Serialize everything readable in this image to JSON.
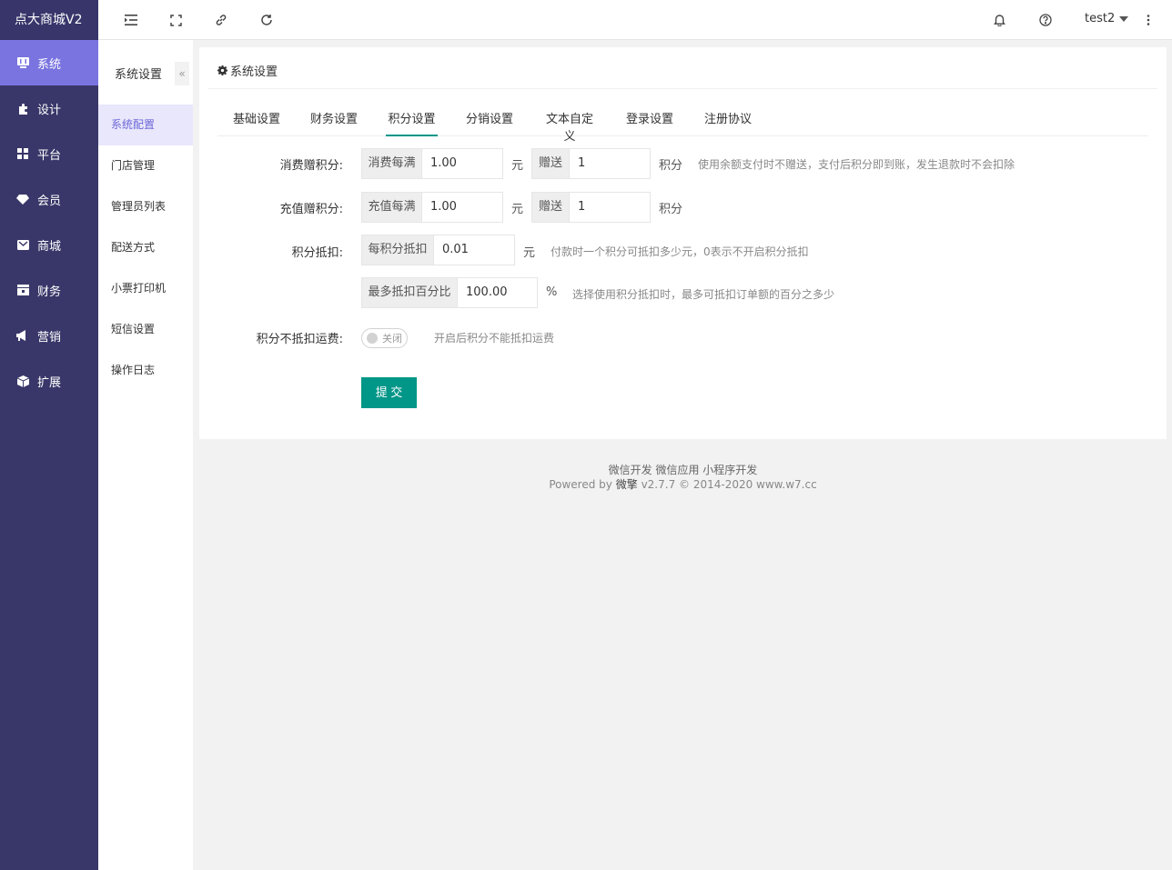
{
  "app": {
    "title": "点大商城V2"
  },
  "nav": [
    {
      "label": "系统",
      "icon": "system-icon",
      "active": true
    },
    {
      "label": "设计",
      "icon": "puzzle-icon"
    },
    {
      "label": "平台",
      "icon": "grid-icon"
    },
    {
      "label": "会员",
      "icon": "gem-icon"
    },
    {
      "label": "商城",
      "icon": "mail-icon"
    },
    {
      "label": "财务",
      "icon": "wallet-icon"
    },
    {
      "label": "营销",
      "icon": "megaphone-icon"
    },
    {
      "label": "扩展",
      "icon": "cube-icon"
    }
  ],
  "header": {
    "user": "test2"
  },
  "subnav": {
    "title": "系统设置",
    "collapse": "«",
    "items": [
      "系统配置",
      "门店管理",
      "管理员列表",
      "配送方式",
      "小票打印机",
      "短信设置",
      "操作日志"
    ]
  },
  "card": {
    "title": "系统设置"
  },
  "tabs": [
    "基础设置",
    "财务设置",
    "积分设置",
    "分销设置",
    "文本自定义",
    "登录设置",
    "注册协议"
  ],
  "form": {
    "consume": {
      "label": "消费赠积分:",
      "addon1": "消费每满",
      "value1": "1.00",
      "unit1": "元",
      "addon2": "赠送",
      "value2": "1",
      "unit2": "积分",
      "hint": "使用余额支付时不赠送，支付后积分即到账，发生退款时不会扣除"
    },
    "recharge": {
      "label": "充值赠积分:",
      "addon1": "充值每满",
      "value1": "1.00",
      "unit1": "元",
      "addon2": "赠送",
      "value2": "1",
      "unit2": "积分"
    },
    "deduct": {
      "label": "积分抵扣:",
      "addon": "每积分抵扣",
      "value": "0.01",
      "unit": "元",
      "hint": "付款时一个积分可抵扣多少元，0表示不开启积分抵扣"
    },
    "max_percent": {
      "addon": "最多抵扣百分比",
      "value": "100.00",
      "unit": "%",
      "hint": "选择使用积分抵扣时，最多可抵扣订单额的百分之多少"
    },
    "freight": {
      "label": "积分不抵扣运费:",
      "switch_text": "关闭",
      "hint": "开启后积分不能抵扣运费"
    },
    "submit": "提 交"
  },
  "footer": {
    "links": "微信开发 微信应用 小程序开发",
    "powered_prefix": "Powered by",
    "brand": "微擎",
    "version": "v2.7.7 © 2014-2020 www.w7.cc"
  }
}
